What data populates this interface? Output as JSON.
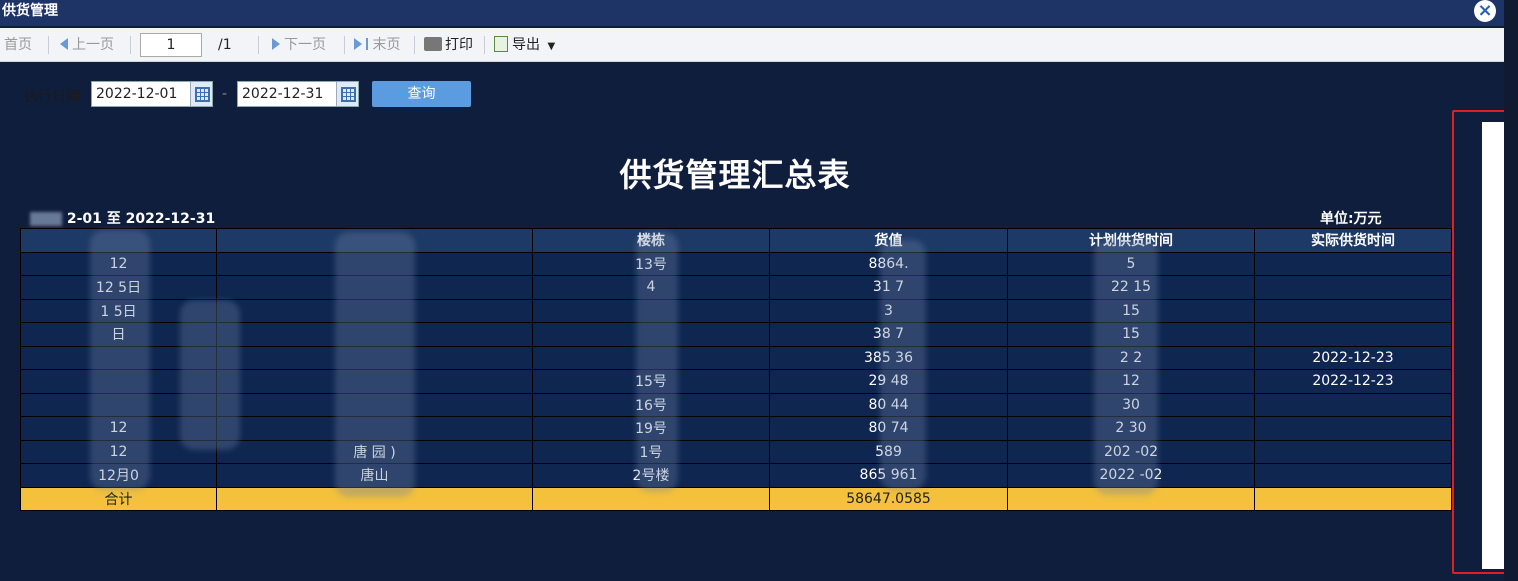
{
  "window": {
    "title": "供货管理"
  },
  "toolbar": {
    "first": "首页",
    "prev": "上一页",
    "page_value": "1",
    "page_total": "/1",
    "next": "下一页",
    "last": "末页",
    "print": "打印",
    "export": "导出"
  },
  "filter": {
    "label": "执行日期",
    "date_from": "2022-12-01",
    "date_sep": "-",
    "date_to": "2022-12-31",
    "query": "查询"
  },
  "report": {
    "title": "供货管理汇总表",
    "range": "2-01 至 2022-12-31",
    "unit": "单位:万元",
    "headers": [
      "",
      "",
      "楼栋",
      "货值",
      "计划供货时间",
      "实际供货时间"
    ],
    "rows": [
      [
        "12",
        "",
        "13号",
        "8864.",
        "5",
        ""
      ],
      [
        "12 5日",
        "",
        "4",
        "31 7",
        "22 15",
        ""
      ],
      [
        "1 5日",
        "",
        "",
        "3",
        "15",
        ""
      ],
      [
        "日",
        "",
        "",
        "38 7",
        "15",
        ""
      ],
      [
        "",
        "",
        "",
        "385 36",
        "2 2",
        "2022-12-23"
      ],
      [
        "",
        "",
        "15号",
        "29 48",
        "12",
        "2022-12-23"
      ],
      [
        "",
        "",
        "16号",
        "80 44",
        "30",
        ""
      ],
      [
        "12",
        "",
        "19号",
        "80 74",
        "2 30",
        ""
      ],
      [
        "12",
        "唐 园 )",
        "1号",
        "589",
        "202 -02",
        ""
      ],
      [
        "12月0",
        "唐山",
        "2号楼",
        "865 961",
        "2022 -02",
        ""
      ]
    ],
    "total_label": "合计",
    "total_value": "58647.0585"
  },
  "colors": {
    "accent": "#5b9be0",
    "total_row": "#f3c13c",
    "background": "#0f1e3c"
  }
}
